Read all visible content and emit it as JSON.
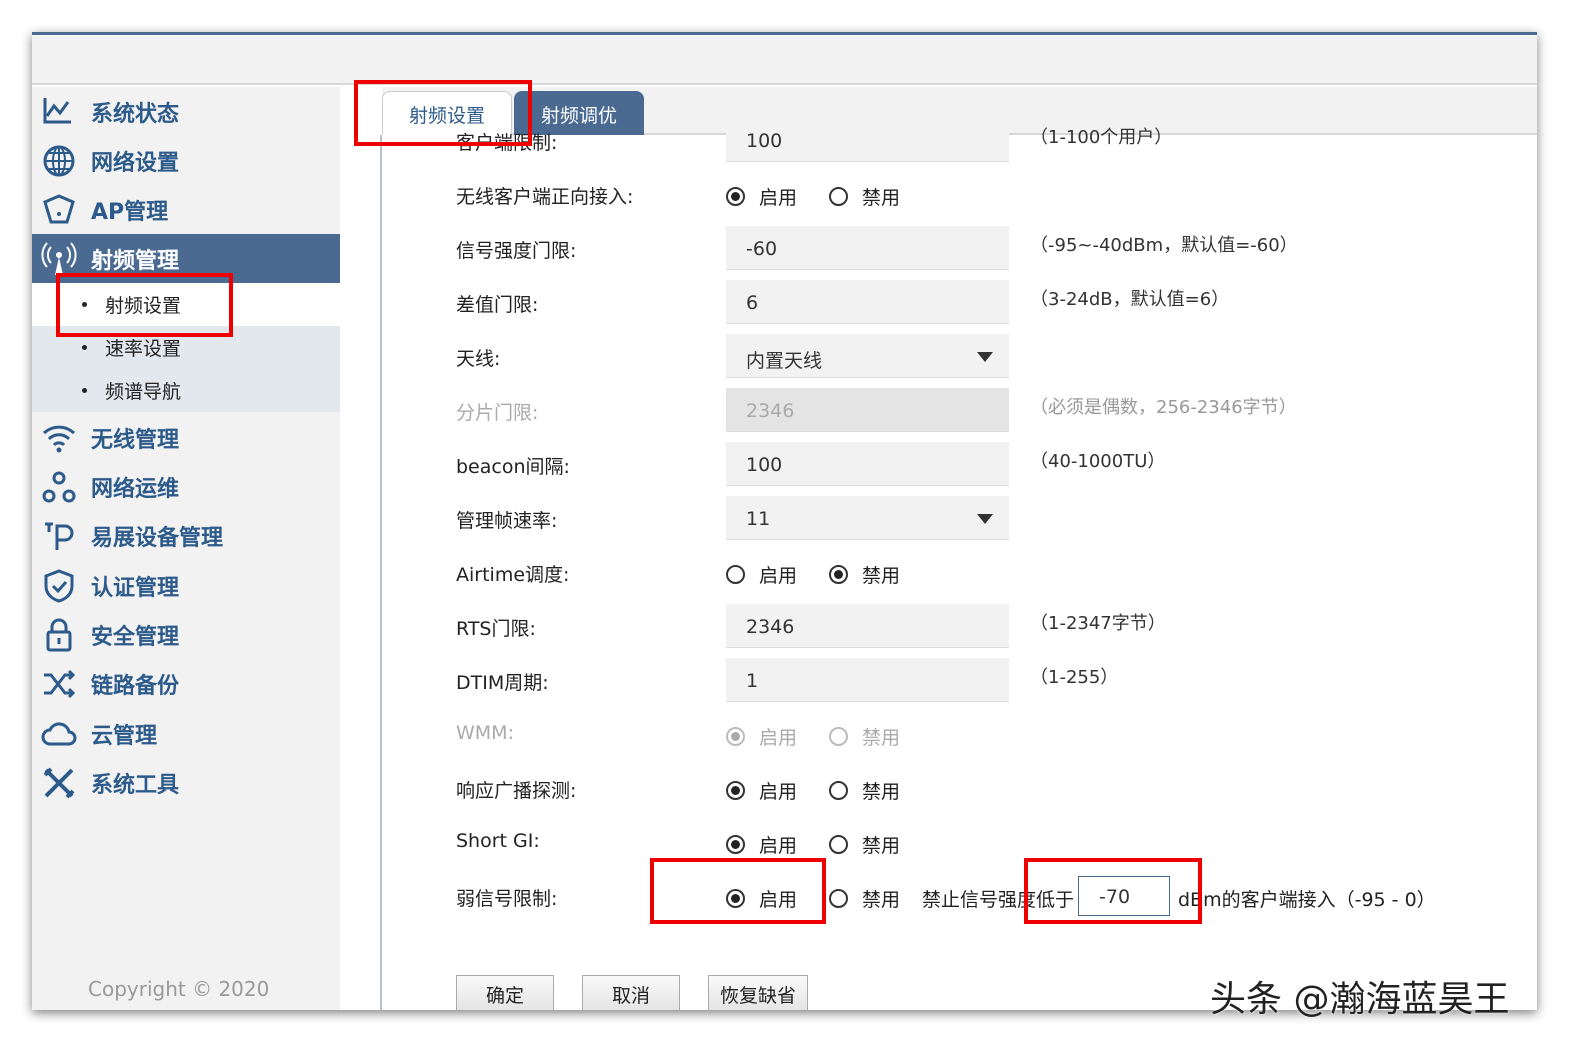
{
  "sidebar": {
    "items": [
      {
        "label": "系统状态",
        "icon": "chart-line-icon"
      },
      {
        "label": "网络设置",
        "icon": "globe-icon"
      },
      {
        "label": "AP管理",
        "icon": "ap-icon"
      },
      {
        "label": "射频管理",
        "icon": "antenna-icon"
      },
      {
        "label": "无线管理",
        "icon": "wifi-icon"
      },
      {
        "label": "网络运维",
        "icon": "network-ops-icon"
      },
      {
        "label": "易展设备管理",
        "icon": "easy-expand-icon"
      },
      {
        "label": "认证管理",
        "icon": "shield-icon"
      },
      {
        "label": "安全管理",
        "icon": "lock-icon"
      },
      {
        "label": "链路备份",
        "icon": "shuffle-icon"
      },
      {
        "label": "云管理",
        "icon": "cloud-icon"
      },
      {
        "label": "系统工具",
        "icon": "tools-icon"
      }
    ],
    "subitems": [
      "射频设置",
      "速率设置",
      "频谱导航"
    ],
    "copyright": "Copyright © 2020"
  },
  "tabs": [
    "射频设置",
    "射频调优"
  ],
  "form": {
    "rows": [
      {
        "label": "客户端限制:",
        "type": "input",
        "value": "100",
        "hint": "（1-100个用户）"
      },
      {
        "label": "无线客户端正向接入:",
        "type": "radio",
        "on": 0
      },
      {
        "label": "信号强度门限:",
        "type": "input",
        "value": "-60",
        "hint": "（-95~-40dBm，默认值=-60）"
      },
      {
        "label": "差值门限:",
        "type": "input",
        "value": "6",
        "hint": "（3-24dB，默认值=6）"
      },
      {
        "label": "天线:",
        "type": "select",
        "value": "内置天线"
      },
      {
        "label": "分片门限:",
        "type": "input",
        "value": "2346",
        "hint": "（必须是偶数，256-2346字节）",
        "disabled": true
      },
      {
        "label": "beacon间隔:",
        "type": "input",
        "value": "100",
        "hint": "（40-1000TU）"
      },
      {
        "label": "管理帧速率:",
        "type": "select",
        "value": "11"
      },
      {
        "label": "Airtime调度:",
        "type": "radio",
        "on": 1
      },
      {
        "label": "RTS门限:",
        "type": "input",
        "value": "2346",
        "hint": "（1-2347字节）"
      },
      {
        "label": "DTIM周期:",
        "type": "input",
        "value": "1",
        "hint": "（1-255）"
      },
      {
        "label": "WMM:",
        "type": "radio",
        "on": 0,
        "disabled": true
      },
      {
        "label": "响应广播探测:",
        "type": "radio",
        "on": 0
      },
      {
        "label": "Short GI:",
        "type": "radio",
        "on": 0
      },
      {
        "label": "弱信号限制:",
        "type": "radio",
        "on": 0,
        "extra": {
          "prefix": "禁止信号强度低于",
          "value": "-70",
          "suffix": "dBm的客户端接入（-95 - 0）"
        }
      }
    ],
    "radio_labels": [
      "启用",
      "禁用"
    ],
    "buttons": [
      "确定",
      "取消",
      "恢复缺省"
    ]
  },
  "watermark": "头条 @瀚海蓝昊王",
  "colors": {
    "accent": "#4a6a92",
    "highlight": "#ee0000"
  }
}
